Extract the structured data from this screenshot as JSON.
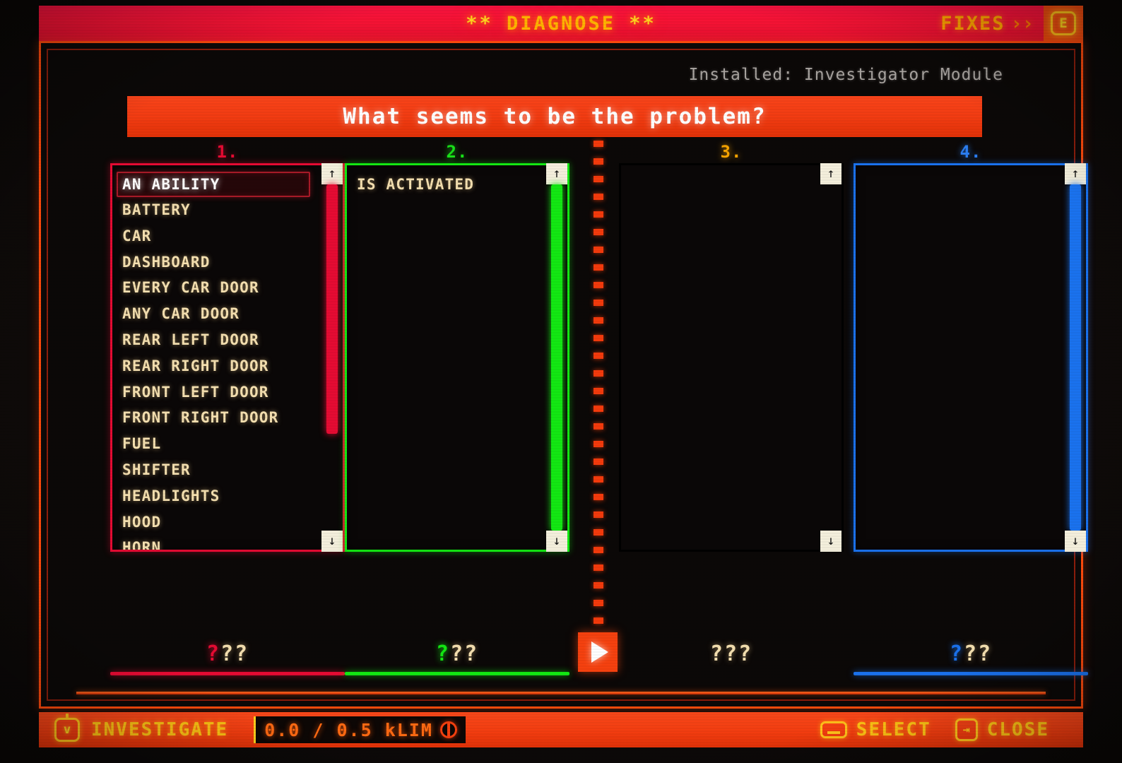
{
  "titlebar": {
    "title": "DIAGNOSE",
    "star_left": "**",
    "star_right": "**",
    "fixes_label": "FIXES",
    "fixes_chevron": "››",
    "key_badge": "E"
  },
  "header": {
    "installed": "Installed: Investigator Module",
    "question": "What seems to be the problem?"
  },
  "columns": [
    {
      "index_label": "1.",
      "color": "#e60b33",
      "header_color": "#e60b33",
      "items": [
        "AN ABILITY",
        "BATTERY",
        "CAR",
        "DASHBOARD",
        "EVERY CAR DOOR",
        "ANY CAR DOOR",
        "REAR LEFT DOOR",
        "REAR RIGHT DOOR",
        "FRONT LEFT DOOR",
        "FRONT RIGHT DOOR",
        "FUEL",
        "SHIFTER",
        "HEADLIGHTS",
        "HOOD",
        "HORN"
      ],
      "selected_index": 0,
      "scroll_up_icon": "↑",
      "scroll_down_icon": "↓",
      "scroll_thumb_top_pct": 0,
      "scroll_thumb_height_pct": 72,
      "answer": "???"
    },
    {
      "index_label": "2.",
      "color": "#13e813",
      "header_color": "#19e219",
      "items": [
        "IS ACTIVATED"
      ],
      "selected_index": -1,
      "scroll_up_icon": "↑",
      "scroll_down_icon": "↓",
      "scroll_thumb_top_pct": 0,
      "scroll_thumb_height_pct": 100,
      "answer": "???"
    },
    {
      "index_label": "3.",
      "color": "#f7a породы00",
      "header_color": "#f7a400",
      "items": [],
      "selected_index": -1,
      "scroll_up_icon": "↑",
      "scroll_down_icon": "↓",
      "scroll_thumb_top_pct": 0,
      "scroll_thumb_height_pct": 100,
      "answer": "???"
    },
    {
      "index_label": "4.",
      "color": "#1a72ee",
      "header_color": "#2b7ef2",
      "items": [],
      "selected_index": -1,
      "scroll_up_icon": "↑",
      "scroll_down_icon": "↓",
      "scroll_thumb_top_pct": 0,
      "scroll_thumb_height_pct": 100,
      "answer": "???"
    }
  ],
  "submit": {
    "icon": "play-triangle"
  },
  "statusbar": {
    "key_badge": "v",
    "investigate_label": "INVESTIGATE",
    "readout": "0.0 / 0.5 kLIM",
    "select_label": "SELECT",
    "close_label": "CLOSE",
    "tab_icon": "⇥"
  }
}
